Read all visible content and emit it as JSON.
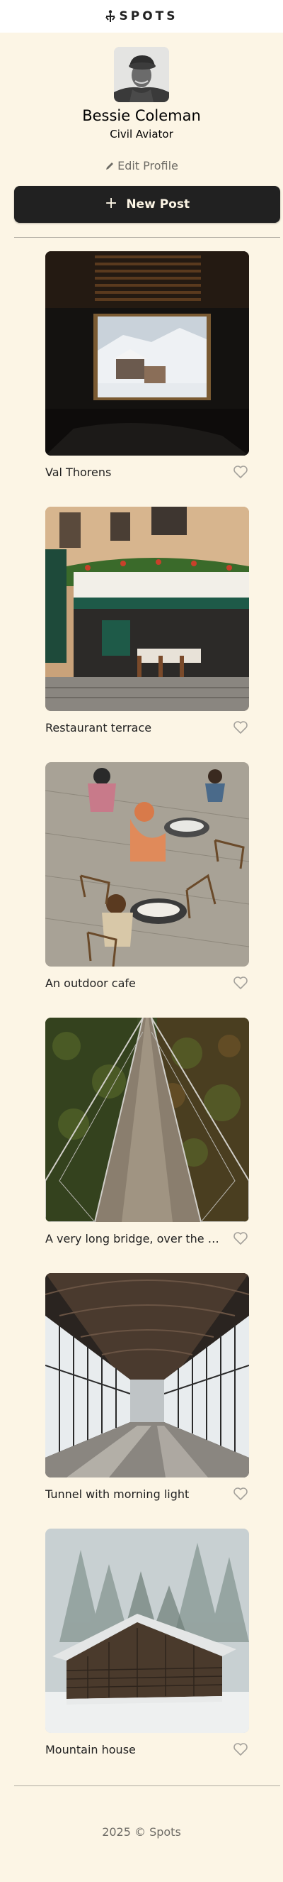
{
  "header": {
    "logo_text": "SPOTS",
    "logo_icon": "spots-logo-icon"
  },
  "profile": {
    "name": "Bessie Coleman",
    "role": "Civil Aviator",
    "edit_label": "Edit Profile",
    "edit_icon": "pencil-icon"
  },
  "actions": {
    "new_post_label": "New Post",
    "new_post_icon": "plus-icon"
  },
  "cards": [
    {
      "caption": "Val Thorens",
      "liked": false
    },
    {
      "caption": "Restaurant terrace",
      "liked": false
    },
    {
      "caption": "An outdoor cafe",
      "liked": false
    },
    {
      "caption": "A very long bridge, over the forest and through the trees",
      "liked": false
    },
    {
      "caption": "Tunnel with morning light",
      "liked": false
    },
    {
      "caption": "Mountain house",
      "liked": false
    }
  ],
  "footer": {
    "text": "2025 © Spots"
  },
  "colors": {
    "background": "#fcf5e5",
    "primary": "#212121",
    "muted": "#a5a29c"
  }
}
